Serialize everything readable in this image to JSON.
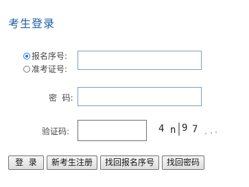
{
  "title": "考生登录",
  "login_type": {
    "options": [
      {
        "label": "报名序号:",
        "selected": true
      },
      {
        "label": "准考证号:",
        "selected": false
      }
    ]
  },
  "fields": {
    "id_value": "",
    "password_label": "密  码:",
    "password_value": "",
    "captcha_label": "验证码:",
    "captcha_value": ""
  },
  "captcha": {
    "chars": [
      "4",
      "n",
      "9",
      "7"
    ]
  },
  "buttons": {
    "login": "登  录",
    "register": "新考生注册",
    "find_reg_no": "找回报名序号",
    "find_password": "找回密码"
  },
  "colors": {
    "title": "#1c5d9f",
    "input_border": "#7f9db9"
  }
}
